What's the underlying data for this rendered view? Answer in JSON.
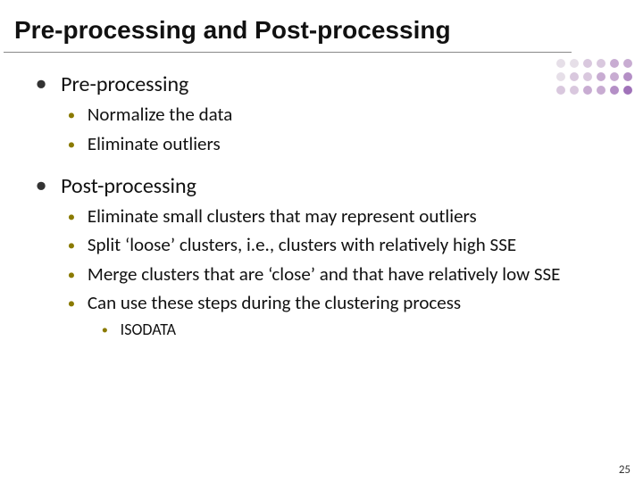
{
  "title": "Pre-processing and Post-processing",
  "section1": {
    "heading": "Pre-processing",
    "items": [
      "Normalize the data",
      "Eliminate outliers"
    ]
  },
  "section2": {
    "heading": "Post-processing",
    "items": [
      "Eliminate small clusters that may represent outliers",
      "Split ‘loose’ clusters, i.e., clusters with relatively high SSE",
      "Merge clusters that are ‘close’ and that have relatively low SSE",
      "Can use these steps during the clustering process"
    ],
    "subitems": [
      "ISODATA"
    ]
  },
  "pageNumber": "25",
  "deco_colors": [
    "#e6dfe8",
    "#e6dfe8",
    "#d9c8de",
    "#d9c8de",
    "#c8acd2",
    "#c8acd2",
    "#e6dfe8",
    "#d9c8de",
    "#d9c8de",
    "#c8acd2",
    "#c8acd2",
    "#b48fc6",
    "#d9c8de",
    "#d9c8de",
    "#c8acd2",
    "#c8acd2",
    "#b48fc6",
    "#a072b9"
  ]
}
